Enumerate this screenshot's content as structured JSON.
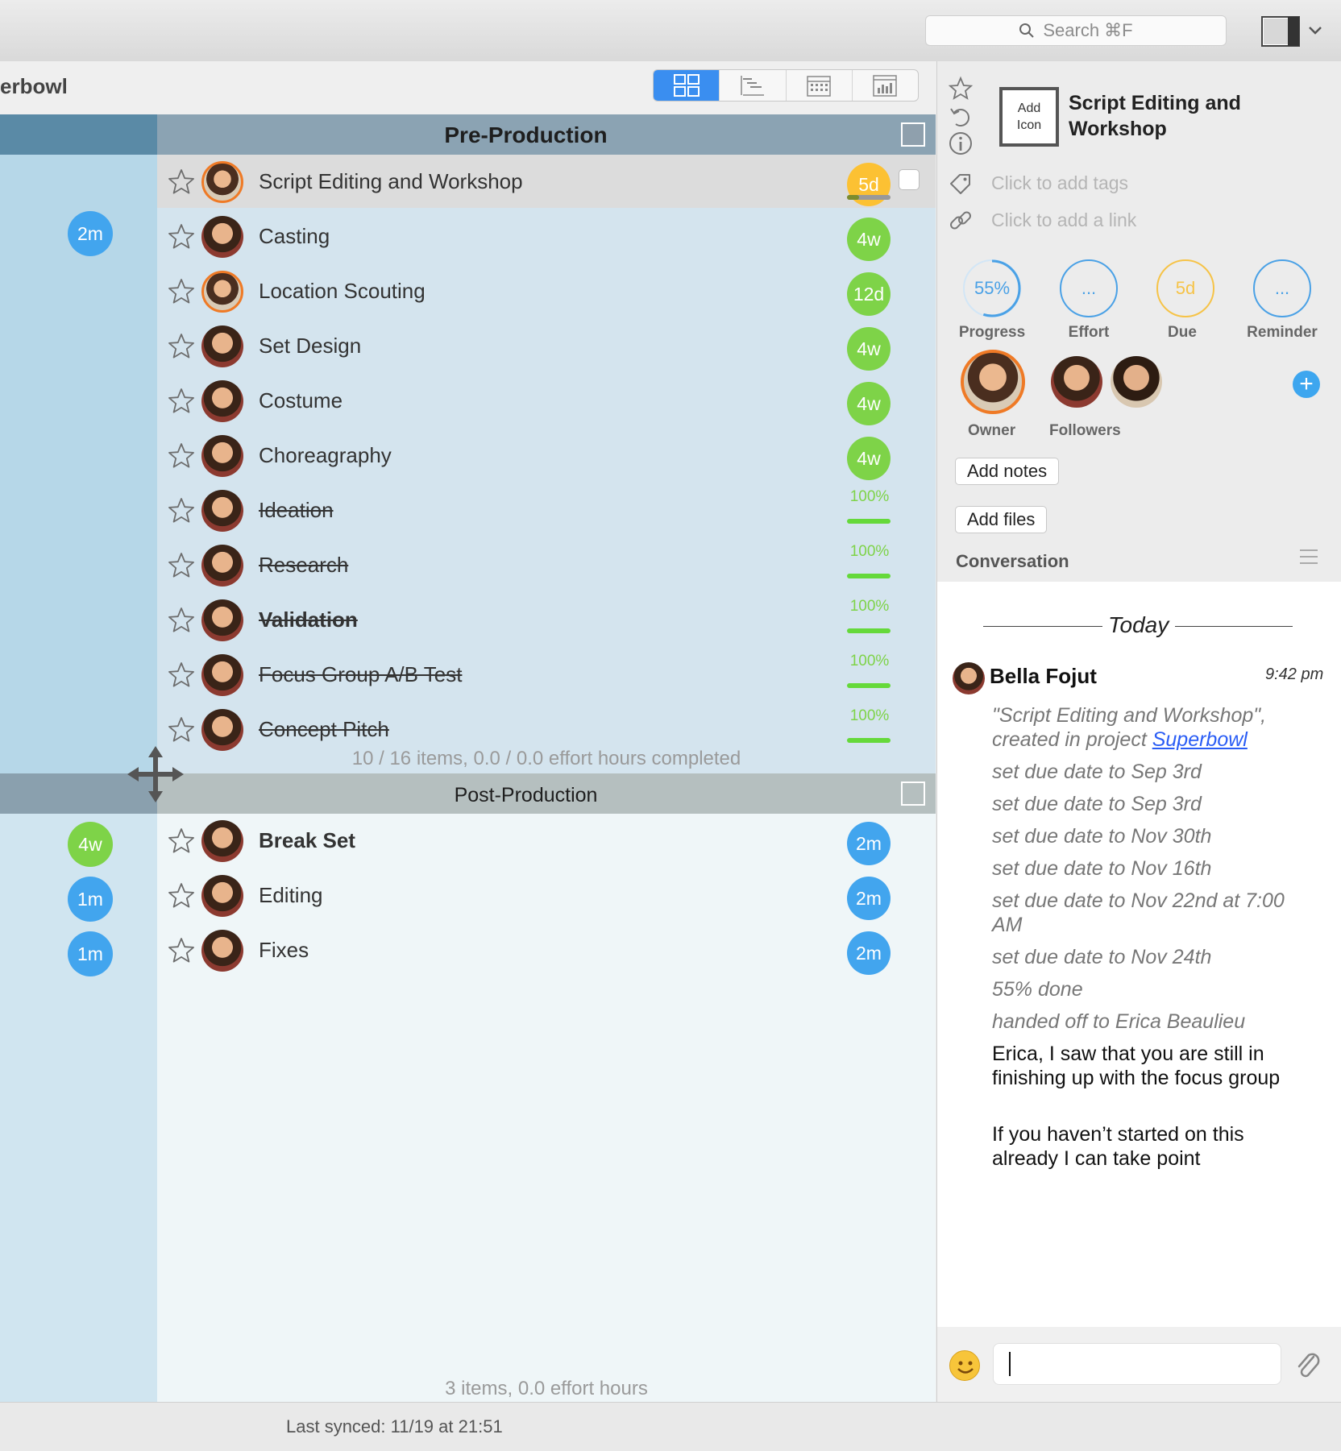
{
  "toolbar": {
    "search_placeholder": "Search ⌘F"
  },
  "project": {
    "title": "erbowl"
  },
  "sections": [
    {
      "title": "Pre-Production",
      "summary": "10 / 16 items, 0.0 / 0.0 effort hours completed",
      "lane_badges": [
        {
          "label": "2m",
          "color": "blue"
        }
      ],
      "tasks": [
        {
          "label": "Script Editing and Workshop",
          "badge": "5d",
          "badge_color": "yellow",
          "selected": true
        },
        {
          "label": "Casting",
          "badge": "4w",
          "badge_color": "green"
        },
        {
          "label": "Location Scouting",
          "badge": "12d",
          "badge_color": "green"
        },
        {
          "label": "Set Design",
          "badge": "4w",
          "badge_color": "green"
        },
        {
          "label": "Costume",
          "badge": "4w",
          "badge_color": "green"
        },
        {
          "label": "Choreagraphy",
          "badge": "4w",
          "badge_color": "green"
        },
        {
          "label": "Ideation",
          "percent": "100%",
          "done": true
        },
        {
          "label": "Research",
          "percent": "100%",
          "done": true
        },
        {
          "label": "Validation",
          "percent": "100%",
          "done": true
        },
        {
          "label": "Focus Group A/B Test",
          "percent": "100%",
          "done": true
        },
        {
          "label": "Concept Pitch",
          "percent": "100%",
          "done": true
        }
      ]
    },
    {
      "title": "Post-Production",
      "summary": "3 items, 0.0 effort hours",
      "lane_badges": [
        {
          "label": "4w",
          "color": "green"
        },
        {
          "label": "1m",
          "color": "blue"
        },
        {
          "label": "1m",
          "color": "blue"
        }
      ],
      "tasks": [
        {
          "label": "Break Set",
          "badge": "2m",
          "badge_color": "blue"
        },
        {
          "label": "Editing",
          "badge": "2m",
          "badge_color": "blue"
        },
        {
          "label": "Fixes",
          "badge": "2m",
          "badge_color": "blue"
        }
      ]
    }
  ],
  "status": {
    "last_synced": "Last synced: 11/19 at 21:51"
  },
  "detail": {
    "add_icon_line1": "Add",
    "add_icon_line2": "Icon",
    "title": "Script Editing and Workshop",
    "tags_placeholder": "Click to add tags",
    "link_placeholder": "Click to add a link",
    "metrics": {
      "progress": {
        "value": "55%",
        "label": "Progress",
        "fraction": 0.55
      },
      "effort": {
        "value": "...",
        "label": "Effort"
      },
      "due": {
        "value": "5d",
        "label": "Due"
      },
      "reminder": {
        "value": "...",
        "label": "Reminder"
      }
    },
    "owner_label": "Owner",
    "followers_label": "Followers",
    "add_notes": "Add notes",
    "add_files": "Add files",
    "conversation_title": "Conversation",
    "today": "Today",
    "chat": {
      "author": "Bella Fojut",
      "time": "9:42 pm",
      "created_prefix": "\"Script Editing and Workshop\", created in project ",
      "created_link": "Superbowl",
      "log": [
        "set due date to Sep 3rd",
        "set due date to Sep 3rd",
        "set due date to Nov 30th",
        "set due date to Nov 16th",
        "set due date to Nov 22nd at 7:00 AM",
        "set due date to Nov 24th",
        "55% done",
        "handed off to Erica Beaulieu"
      ],
      "messages": [
        "Erica, I saw that you are still in finishing up with the focus group",
        "If you haven’t started on this already I can take point"
      ]
    }
  },
  "colors": {
    "accent": "#3a8ef0",
    "green": "#7ed348",
    "blue": "#42a5ee",
    "yellow": "#fcc133",
    "owner_ring": "#ef7a26"
  }
}
